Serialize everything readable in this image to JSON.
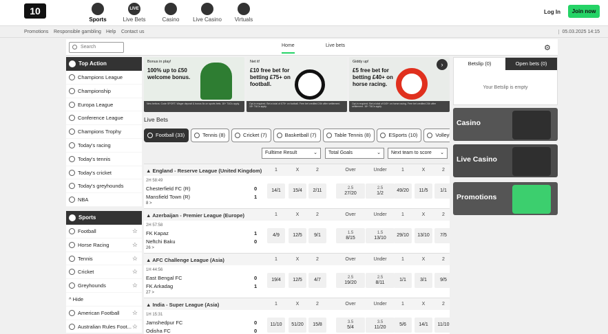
{
  "header": {
    "logo": "10",
    "nav": [
      {
        "label": "Sports",
        "icon": "football-icon",
        "glyph": "",
        "active": true
      },
      {
        "label": "Live Bets",
        "icon": "live-icon",
        "glyph": "LIVE",
        "active": false
      },
      {
        "label": "Casino",
        "icon": "casino-chip-icon",
        "glyph": "",
        "active": false
      },
      {
        "label": "Live Casino",
        "icon": "live-casino-icon",
        "glyph": "",
        "active": false
      },
      {
        "label": "Virtuals",
        "icon": "virtuals-icon",
        "glyph": "",
        "active": false
      }
    ],
    "login": "Log In",
    "join": "Join now",
    "accent": "#25d366"
  },
  "subnav": {
    "links": [
      "Promotions",
      "Responsible gambling",
      "Help",
      "Contact us"
    ],
    "datetime": "05.03.2025 14:15"
  },
  "toolbar": {
    "search_placeholder": "Search",
    "tabs": [
      {
        "label": "Home",
        "active": true
      },
      {
        "label": "Live bets",
        "active": false
      }
    ]
  },
  "sidebar": {
    "top_action_title": "Top Action",
    "top_action": [
      "Champions League",
      "Championship",
      "Europa League",
      "Conference League",
      "Champions Trophy",
      "Today's racing",
      "Today's tennis",
      "Today's cricket",
      "Today's greyhounds",
      "NBA"
    ],
    "sports_title": "Sports",
    "sports": [
      "Football",
      "Horse Racing",
      "Tennis",
      "Cricket",
      "Greyhounds"
    ],
    "hide_label": "Hide",
    "more_sports": [
      "American Football",
      "Australian Rules Foot..."
    ]
  },
  "banners": [
    {
      "tag": "Bonus in play!",
      "headline": "100% up to £50 welcome bonus.",
      "fine": "New bettors: Code SPORT. Wager deposit & bonus 6x on sports bets. 18+ T&Cs apply."
    },
    {
      "tag": "Net it!",
      "headline": "£10 free bet for betting £75+ on football.",
      "fine": "Opt-in required. Bet a total of £75+ on football. Free bet credited 24h after settlement. 18+ T&Cs apply."
    },
    {
      "tag": "Giddy up!",
      "headline": "£5 free bet for betting £40+ on horse racing.",
      "fine": "Opt-in required. Bet a total of £40+ on horse racing. Free bet credited 24h after settlement. 18+ T&Cs apply."
    }
  ],
  "live_bets": {
    "title": "Live Bets",
    "chips": [
      {
        "label": "Football (33)",
        "active": true
      },
      {
        "label": "Tennis (8)",
        "active": false
      },
      {
        "label": "Cricket (7)",
        "active": false
      },
      {
        "label": "Basketball (7)",
        "active": false
      },
      {
        "label": "Table Tennis (8)",
        "active": false
      },
      {
        "label": "ESports (10)",
        "active": false
      },
      {
        "label": "Volleyball",
        "active": false
      }
    ],
    "markets": [
      "Fulltime Result",
      "Total Goals",
      "Next team to score"
    ],
    "col_headers": [
      "1",
      "X",
      "2",
      "Over",
      "Under",
      "1",
      "X",
      "2"
    ],
    "groups": [
      {
        "league": "England - Reserve League (United Kingdom)",
        "time": "2H 58:49",
        "home": "Chesterfield FC (R)",
        "away": "Mansfield Town (R)",
        "home_score": "0",
        "away_score": "1",
        "more": "8 >",
        "odds": [
          "14/1",
          "15/4",
          "2/11",
          "2.5|27/20",
          "2.5|1/2",
          "49/20",
          "11/5",
          "1/1"
        ]
      },
      {
        "league": "Azerbaijan - Premier League (Europe)",
        "time": "2H 57:58",
        "home": "FK Kapaz",
        "away": "Neftchi Baku",
        "home_score": "1",
        "away_score": "0",
        "more": "26 >",
        "odds": [
          "4/9",
          "12/5",
          "9/1",
          "1.5|8/15",
          "1.5|13/10",
          "29/10",
          "13/10",
          "7/5"
        ]
      },
      {
        "league": "AFC Challenge League (Asia)",
        "time": "1H 44:56",
        "home": "East Bengal FC",
        "away": "FK Arkadag",
        "home_score": "0",
        "away_score": "1",
        "more": "27 >",
        "odds": [
          "19/4",
          "12/5",
          "4/7",
          "2.5|19/20",
          "2.5|8/11",
          "1/1",
          "3/1",
          "9/5"
        ]
      },
      {
        "league": "India - Super League (Asia)",
        "time": "1H 15:31",
        "home": "Jamshedpur FC",
        "away": "Odisha FC",
        "home_score": "0",
        "away_score": "0",
        "more": "",
        "odds": [
          "11/10",
          "51/20",
          "15/8",
          "3.5|5/4",
          "3.5|11/20",
          "5/6",
          "14/1",
          "11/10"
        ]
      }
    ]
  },
  "betslip": {
    "tabs": [
      {
        "label": "Betslip (0)",
        "active": false
      },
      {
        "label": "Open bets (0)",
        "active": true
      }
    ],
    "empty": "Your Betslip is empty"
  },
  "promos": [
    {
      "label": "Casino",
      "color": "#555555"
    },
    {
      "label": "Live Casino",
      "color": "#4a4a4a"
    },
    {
      "label": "Promotions",
      "color": "#555555"
    }
  ]
}
